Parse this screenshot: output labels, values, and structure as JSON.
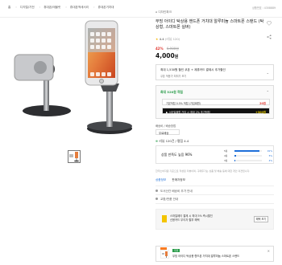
{
  "breadcrumb": [
    "홈",
    "디지털/가전",
    "휴대폰/태블릿",
    "휴대폰액세서리",
    "휴대폰거치대"
  ],
  "product_no": "상품번호 : 4308889",
  "seller": "디자인파크",
  "title": "무빙 아이디 탁상용 핸드폰 거치대 알루미늄 스마트폰 스탠드 (탁상형, 스마트폰 실버)",
  "rating": {
    "score": "4.4",
    "count": "(리뷰 120)"
  },
  "discount": {
    "pct": "42%",
    "orig": "6,900원"
  },
  "price": {
    "value": "4,000",
    "unit": "원"
  },
  "coupon": {
    "line1": "최대 1,530원 할인 쿠폰 + 제휴카드 결제시 추가할인",
    "line2": "쿠폰 적용가 최저가 보기",
    "chev": "⌄"
  },
  "points": {
    "title": "최대 320원 적립",
    "row1": {
      "text": "기본적립 0.5% 적립 (가입회원)",
      "price": "20원"
    },
    "row2": {
      "text": "▶ 스마일클럽 가입 시 최대 2% 추가적립",
      "price": "+300원"
    }
  },
  "delivery": {
    "label": "배송비 / 배송방법",
    "value": "무료배송"
  },
  "review_header": {
    "plus": "⊕",
    "label": "리뷰 120건 / 평점 4.4"
  },
  "review": {
    "summary": "상품 만족도 높음 96%",
    "bars": [
      {
        "label": "5점",
        "pct": "91%",
        "value": 0.91
      },
      {
        "label": "4점",
        "pct": "5%",
        "value": 0.05
      },
      {
        "label": "3점",
        "pct": "4%",
        "value": 0.04
      }
    ]
  },
  "note": "한국소비자원 기준으로 작성된 리뷰이며, 구매후기는 상품 및 배송 등에 대한 개인 의견입니다.",
  "tabs": {
    "a": "상품정보",
    "b": "판매자정보"
  },
  "lines": {
    "l1": "도서산간 배송비 추가 안내",
    "l2": "교환/반품 안내"
  },
  "promo": {
    "text1": "스마일페이 결제 시 최대 5% 즉시할인",
    "text2": "신용카드 무이자 할부 혜택",
    "btn": "혜택 보기"
  },
  "bottom": {
    "badge": "추천",
    "text": "무빙 아이디 탁상용 핸드폰 거치대 알루미늄 스마트폰 스탠드",
    "close": "✕"
  }
}
